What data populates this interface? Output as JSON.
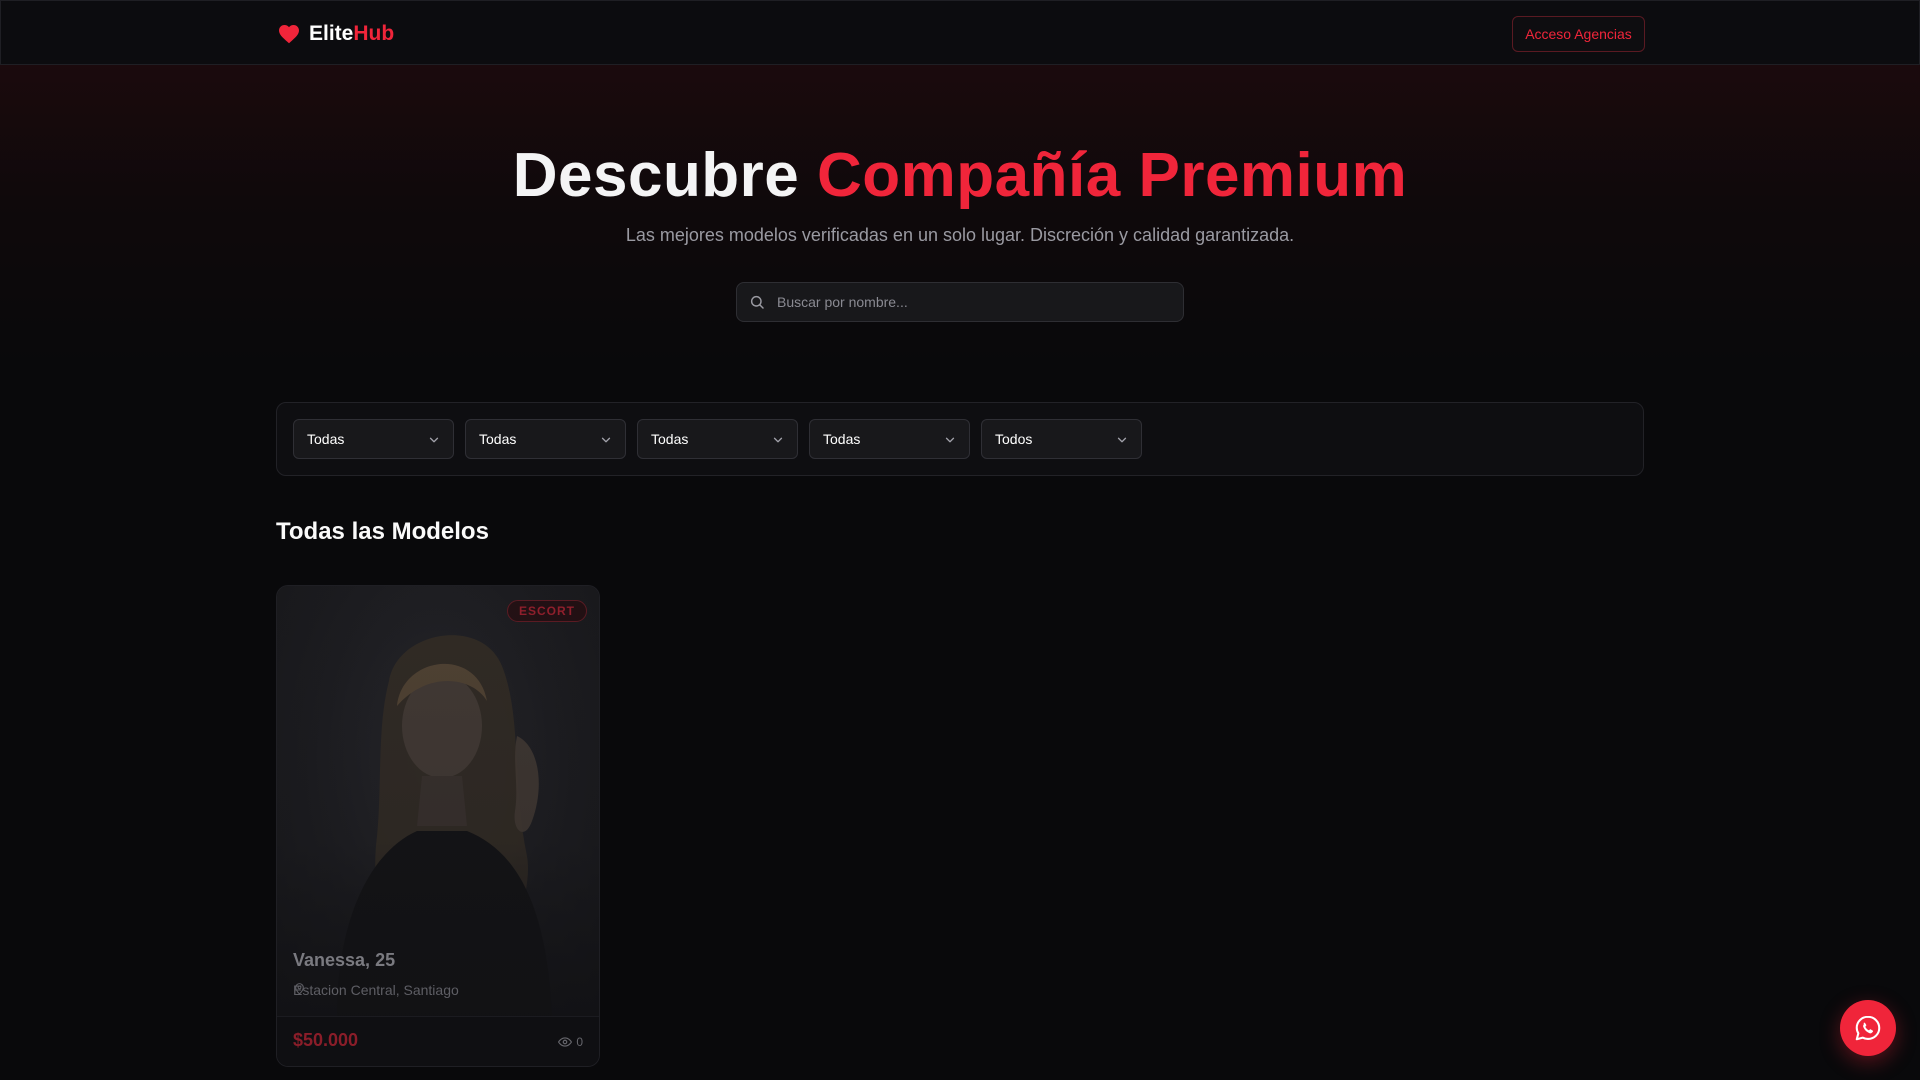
{
  "header": {
    "logo_word1": "Elite",
    "logo_word2": "Hub",
    "logo_icon": "heart-icon",
    "agency_button": "Acceso Agencias"
  },
  "hero": {
    "title_part1": "Descubre",
    "title_part2": "Compañía Premium",
    "subtitle": "Las mejores modelos verificadas en un solo lugar. Discreción y calidad garantizada.",
    "search_placeholder": "Buscar por nombre...",
    "search_icon": "search-icon"
  },
  "filters": [
    {
      "value": "Todas"
    },
    {
      "value": "Todas"
    },
    {
      "value": "Todas"
    },
    {
      "value": "Todas"
    },
    {
      "value": "Todos"
    }
  ],
  "section": {
    "title": "Todas las Modelos"
  },
  "cards": [
    {
      "badge": "ESCORT",
      "name": "Vanessa, 25",
      "location": "Estacion Central, Santiago",
      "price": "$50.000",
      "views": "0"
    }
  ],
  "floating": {
    "icon": "whatsapp-icon"
  },
  "colors": {
    "accent": "#f0253a",
    "background": "#09090b",
    "surface": "#18181b"
  }
}
